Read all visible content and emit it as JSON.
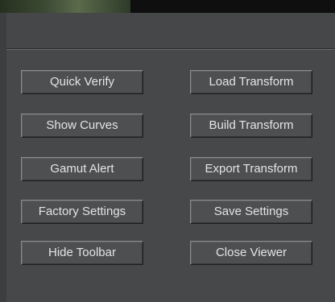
{
  "buttons": {
    "quick_verify": "Quick Verify",
    "load_transform": "Load Transform",
    "show_curves": "Show Curves",
    "build_transform": "Build Transform",
    "gamut_alert": "Gamut Alert",
    "export_transform": "Export Transform",
    "factory_settings": "Factory Settings",
    "save_settings": "Save Settings",
    "hide_toolbar": "Hide Toolbar",
    "close_viewer": "Close Viewer"
  },
  "colors": {
    "panel_background": "#474849",
    "button_face": "#4e4f51",
    "button_text": "#e4e4e4"
  }
}
